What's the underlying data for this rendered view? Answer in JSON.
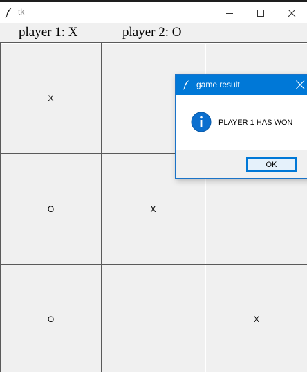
{
  "window": {
    "title": "tk",
    "icon": "tk-feather-icon",
    "controls": [
      "minimize-icon",
      "maximize-icon",
      "close-icon"
    ]
  },
  "header": {
    "player1": "player 1: X",
    "player2": "player 2: O"
  },
  "board": {
    "cells": [
      [
        "X",
        "",
        ""
      ],
      [
        "O",
        "X",
        ""
      ],
      [
        "O",
        "",
        "X"
      ]
    ]
  },
  "dialog": {
    "title": "game result",
    "message": "PLAYER 1 HAS WON",
    "ok_label": "OK",
    "icon": "info-icon",
    "accent": "#0078d7"
  }
}
